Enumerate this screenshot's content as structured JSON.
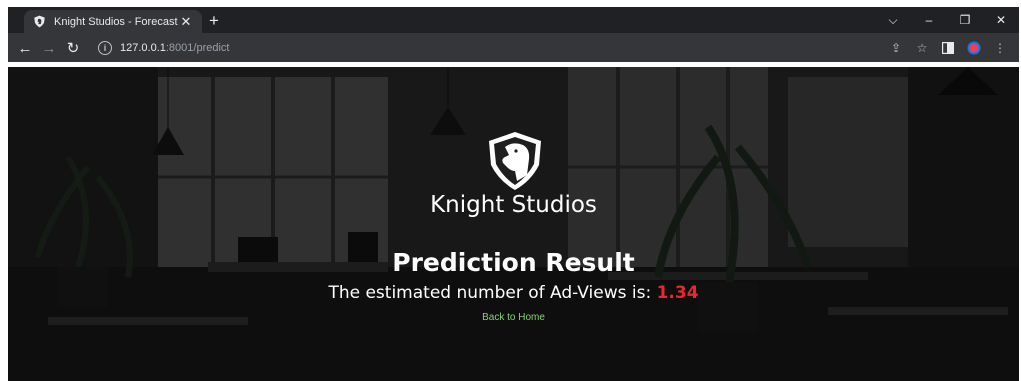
{
  "browser": {
    "tab_title": "Knight Studios - Forecasting",
    "url_host": "127.0.0.1",
    "url_rest": ":8001/predict"
  },
  "page": {
    "brand": "Knight Studios",
    "result_title": "Prediction Result",
    "result_label": "The estimated number of Ad-Views is: ",
    "result_value": "1.34",
    "home_link": "Back to Home"
  },
  "colors": {
    "accent_value": "#e8272e",
    "link": "#7fd66f"
  }
}
